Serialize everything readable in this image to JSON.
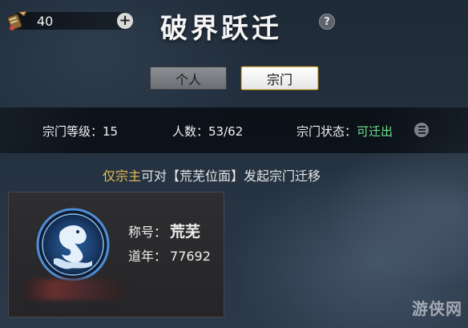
{
  "currency": {
    "value": "40",
    "plus_label": "+"
  },
  "header": {
    "title": "破界跃迁",
    "help_label": "?"
  },
  "tabs": [
    {
      "label": "个人",
      "active": false
    },
    {
      "label": "宗门",
      "active": true
    }
  ],
  "info": {
    "level_label": "宗门等级：",
    "level_value": "15",
    "members_label": "人数：",
    "members_value": "53/62",
    "status_label": "宗门状态：",
    "status_value": "可迁出"
  },
  "notice": {
    "highlight": "仅宗主",
    "text": "可对【荒芜位面】发起宗门迁移"
  },
  "card": {
    "title_label": "称号：",
    "title_value": "荒芜",
    "age_label": "道年：",
    "age_value": "77692"
  },
  "watermark": {
    "text": "游侠网"
  },
  "colors": {
    "status_green": "#6fe08c",
    "highlight_gold": "#e8bf52",
    "emblem_blue": "#4d8fd6"
  },
  "icons": {
    "currency": "ink-brush-scroll-icon",
    "plus": "plus-icon",
    "help": "question-icon",
    "status_list": "list-icon",
    "emblem": "dragon-emblem-icon"
  }
}
